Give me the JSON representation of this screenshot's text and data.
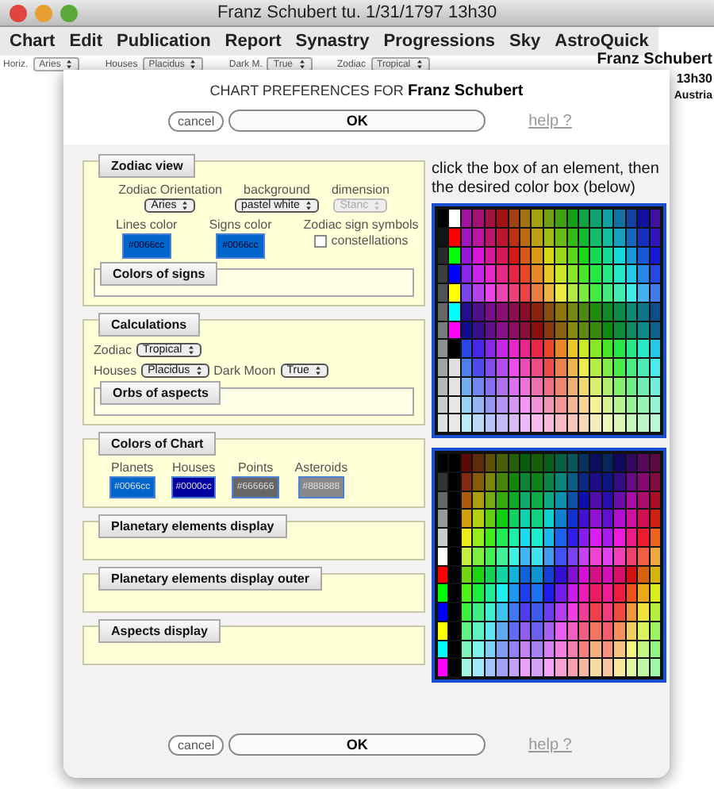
{
  "window": {
    "title": "Franz Schubert tu. 1/31/1797 13h30"
  },
  "menu": [
    "Chart",
    "Edit",
    "Publication",
    "Report",
    "Synastry",
    "Progressions",
    "Sky",
    "AstroQuick"
  ],
  "toolbar": [
    {
      "label": "Horiz.",
      "value": "Aries"
    },
    {
      "label": "Houses",
      "value": "Placidus"
    },
    {
      "label": "Dark M.",
      "value": "True"
    },
    {
      "label": "Zodiac",
      "value": "Tropical"
    }
  ],
  "chart_info": [
    "Franz Schubert",
    "13h30",
    "Austria"
  ],
  "dialog": {
    "title_prefix": "CHART PREFERENCES FOR",
    "title_name": "Franz Schubert",
    "buttons": {
      "cancel": "cancel",
      "ok": "OK",
      "help": "help ?"
    },
    "bottom_buttons": {
      "cancel": "cancel",
      "ok": "OK",
      "help": "help ?"
    },
    "instructions": "click the box of an element, then the desired color box (below)",
    "zodiac_view": {
      "header": "Zodiac view",
      "selects": [
        {
          "label": "Zodiac Orientation",
          "value": "Aries",
          "disabled": false
        },
        {
          "label": "background",
          "value": "pastel white",
          "disabled": false
        },
        {
          "label": "dimension",
          "value": "Stanc",
          "disabled": true
        }
      ],
      "swatches": [
        {
          "label": "Lines color",
          "value": "#0066cc",
          "color": "#0066cc"
        },
        {
          "label": "Signs color",
          "value": "#0066cc",
          "color": "#0066cc"
        }
      ],
      "symbols_label": "Zodiac sign symbols",
      "constellations": {
        "label": "constellations",
        "checked": false
      },
      "subsection": "Colors of signs"
    },
    "calculations": {
      "header": "Calculations",
      "zodiac": {
        "label": "Zodiac",
        "value": "Tropical"
      },
      "houses": {
        "label": "Houses",
        "value": "Placidus"
      },
      "dark_moon": {
        "label": "Dark Moon",
        "value": "True"
      },
      "subsection": "Orbs of aspects"
    },
    "colors_of_chart": {
      "header": "Colors of Chart",
      "swatches": [
        {
          "label": "Planets",
          "value": "#0066cc",
          "color": "#0066cc"
        },
        {
          "label": "Houses",
          "value": "#0000cc",
          "color": "#0000a0"
        },
        {
          "label": "Points",
          "value": "#666666",
          "color": "#666666"
        },
        {
          "label": "Asteroids",
          "value": "#888888",
          "color": "#888888"
        }
      ]
    },
    "collapsed_sections": [
      "Planetary elements display",
      "Planetary elements display outer",
      "Aspects display"
    ]
  }
}
